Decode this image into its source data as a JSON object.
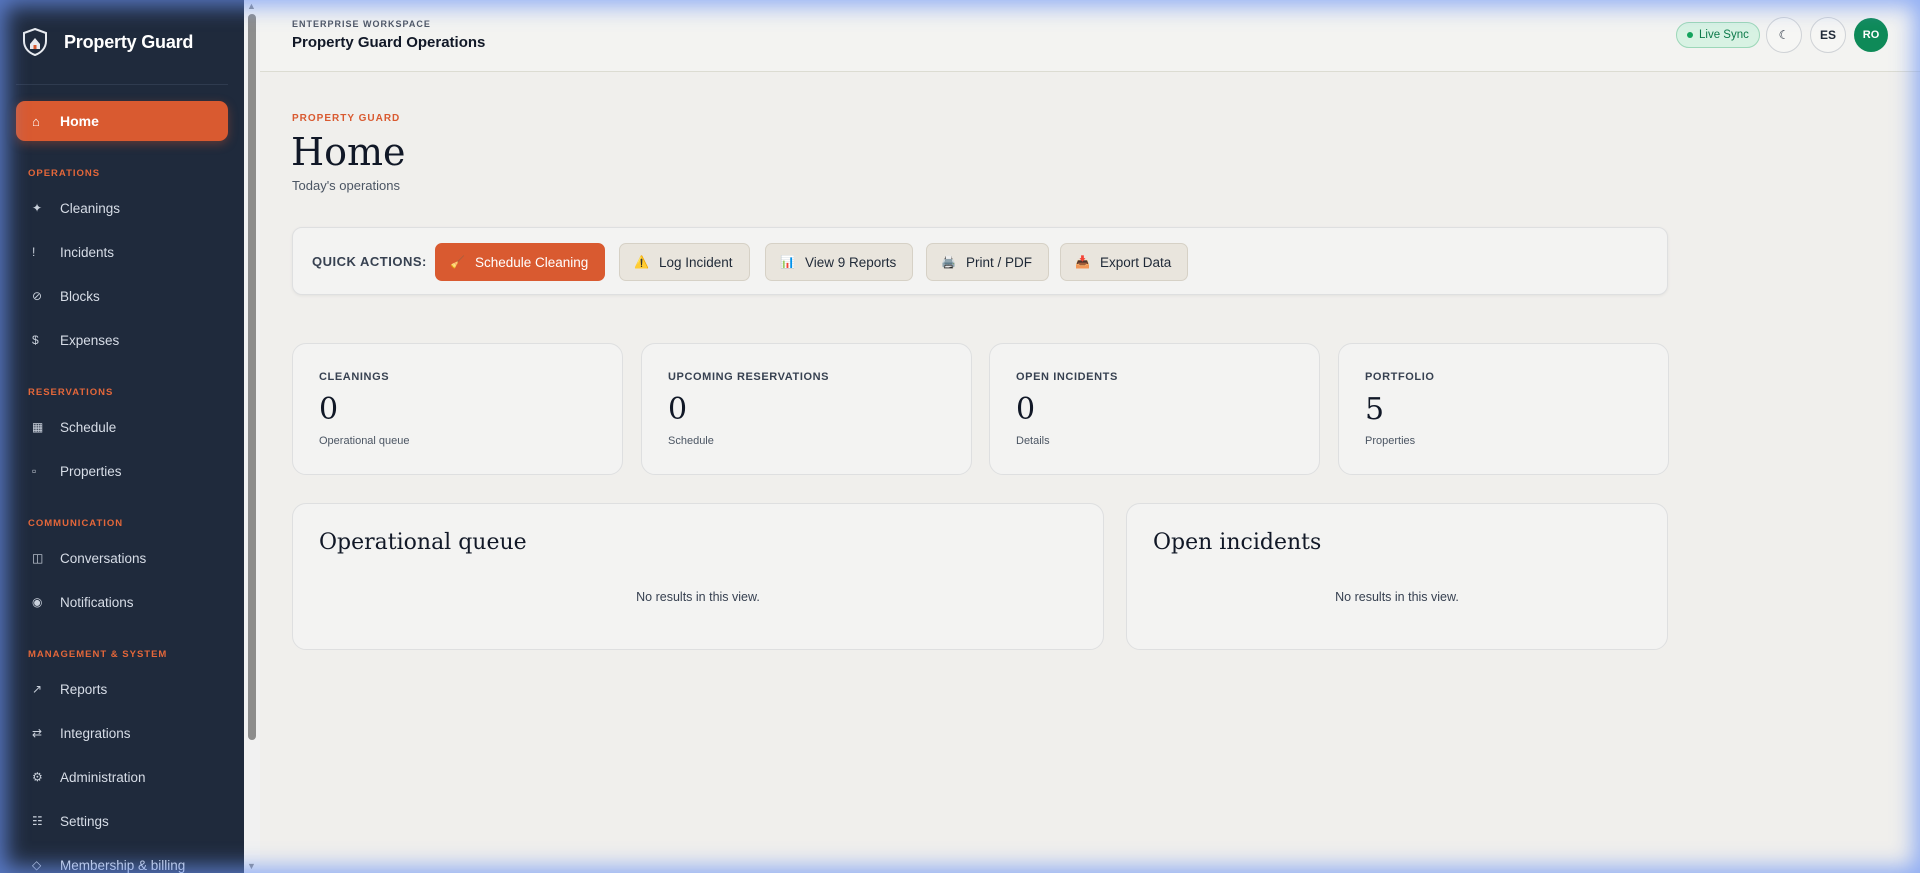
{
  "brand": {
    "name": "Property Guard"
  },
  "sidebar": {
    "home": {
      "label": "Home",
      "icon": "home-icon"
    },
    "sections": [
      {
        "label": "OPERATIONS",
        "items": [
          {
            "label": "Cleanings",
            "icon": "sparkle-icon"
          },
          {
            "label": "Incidents",
            "icon": "exclamation-icon"
          },
          {
            "label": "Blocks",
            "icon": "block-icon"
          },
          {
            "label": "Expenses",
            "icon": "dollar-icon"
          }
        ]
      },
      {
        "label": "RESERVATIONS",
        "items": [
          {
            "label": "Schedule",
            "icon": "calendar-icon"
          },
          {
            "label": "Properties",
            "icon": "building-icon"
          }
        ]
      },
      {
        "label": "COMMUNICATION",
        "items": [
          {
            "label": "Conversations",
            "icon": "chat-icon"
          },
          {
            "label": "Notifications",
            "icon": "bell-icon"
          }
        ]
      },
      {
        "label": "MANAGEMENT & SYSTEM",
        "items": [
          {
            "label": "Reports",
            "icon": "chart-icon"
          },
          {
            "label": "Integrations",
            "icon": "swap-icon"
          },
          {
            "label": "Administration",
            "icon": "gear-icon"
          },
          {
            "label": "Settings",
            "icon": "sliders-icon"
          },
          {
            "label": "Membership & billing",
            "icon": "diamond-icon"
          }
        ]
      }
    ]
  },
  "topbar": {
    "workspace_label": "ENTERPRISE WORKSPACE",
    "workspace_title": "Property Guard Operations",
    "live_sync": "Live Sync",
    "theme_icon": "moon-icon",
    "language": "ES",
    "avatar_initials": "RO"
  },
  "page": {
    "eyebrow": "PROPERTY GUARD",
    "title": "Home",
    "subtitle": "Today's operations"
  },
  "quick_actions": {
    "label": "QUICK ACTIONS:",
    "buttons": [
      {
        "label": "Schedule Cleaning",
        "icon": "broom-icon"
      },
      {
        "label": "Log Incident",
        "icon": "warning-icon"
      },
      {
        "label": "View 9 Reports",
        "icon": "bar-chart-icon"
      },
      {
        "label": "Print / PDF",
        "icon": "printer-icon"
      },
      {
        "label": "Export Data",
        "icon": "download-icon"
      }
    ]
  },
  "stats": [
    {
      "label": "CLEANINGS",
      "value": "0",
      "sub": "Operational queue"
    },
    {
      "label": "UPCOMING RESERVATIONS",
      "value": "0",
      "sub": "Schedule"
    },
    {
      "label": "OPEN INCIDENTS",
      "value": "0",
      "sub": "Details"
    },
    {
      "label": "PORTFOLIO",
      "value": "5",
      "sub": "Properties"
    }
  ],
  "panels": [
    {
      "title": "Operational queue",
      "empty": "No results in this view."
    },
    {
      "title": "Open incidents",
      "empty": "No results in this view."
    }
  ],
  "colors": {
    "sidebar_bg": "#1f2a3c",
    "accent": "#d95a30",
    "success": "#0e8a58"
  }
}
